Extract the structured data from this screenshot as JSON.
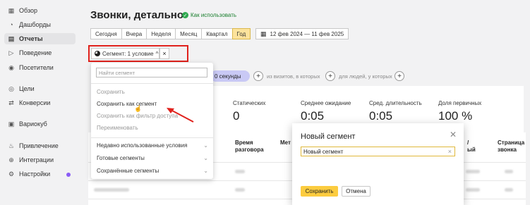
{
  "sidebar": {
    "items": [
      {
        "label": "Обзор",
        "icon": "grid-icon"
      },
      {
        "label": "Дашборды",
        "icon": "dashboard-icon"
      },
      {
        "label": "Отчеты",
        "icon": "reports-icon"
      },
      {
        "label": "Поведение",
        "icon": "play-icon"
      },
      {
        "label": "Посетители",
        "icon": "visitors-icon"
      },
      {
        "label": "Цели",
        "icon": "target-icon"
      },
      {
        "label": "Конверсии",
        "icon": "conversion-icon"
      },
      {
        "label": "Вариокуб",
        "icon": "cube-icon"
      },
      {
        "label": "Привлечение",
        "icon": "flame-icon"
      },
      {
        "label": "Интеграции",
        "icon": "integration-icon"
      },
      {
        "label": "Настройки",
        "icon": "gear-icon"
      }
    ],
    "active_index": 2
  },
  "header": {
    "title": "Звонки, детально",
    "howto": "Как использовать"
  },
  "periods": [
    "Сегодня",
    "Вчера",
    "Неделя",
    "Месяц",
    "Квартал",
    "Год"
  ],
  "selected_period": "Год",
  "date_range": "12 фев 2024 — 11 фев 2025",
  "segment": {
    "label": "Сегмент: 1 условие",
    "close": "×"
  },
  "filters": {
    "chip_text": "0 секунды",
    "visits_text": "из визитов, в которых",
    "people_text": "для людей, у которых"
  },
  "stats": [
    {
      "label": "Статических",
      "value": "0"
    },
    {
      "label": "Среднее ожидание",
      "value": "0:05"
    },
    {
      "label": "Сред. длительность",
      "value": "0:05"
    },
    {
      "label": "Доля первичных",
      "value": "100 %"
    }
  ],
  "table": {
    "headers": [
      "Время разговора",
      "Мет",
      "/ ый",
      "Страница звонка"
    ]
  },
  "dropdown": {
    "search_placeholder": "Найти сегмент",
    "items": [
      {
        "label": "Сохранить",
        "enabled": false
      },
      {
        "label": "Сохранить как сегмент",
        "enabled": true
      },
      {
        "label": "Сохранить как фильтр доступа",
        "enabled": false
      },
      {
        "label": "Переименовать",
        "enabled": false
      }
    ],
    "sections": [
      "Недавно использованные условия",
      "Готовые сегменты",
      "Сохранённые сегменты"
    ]
  },
  "modal": {
    "title": "Новый сегмент",
    "input_value": "Новый сегмент",
    "save": "Сохранить",
    "cancel": "Отмена"
  },
  "colors": {
    "highlight_border": "#e0211c",
    "selected_period": "#fce39c",
    "save_button": "#fccc3f",
    "filter_chip": "#c9c9f5"
  }
}
